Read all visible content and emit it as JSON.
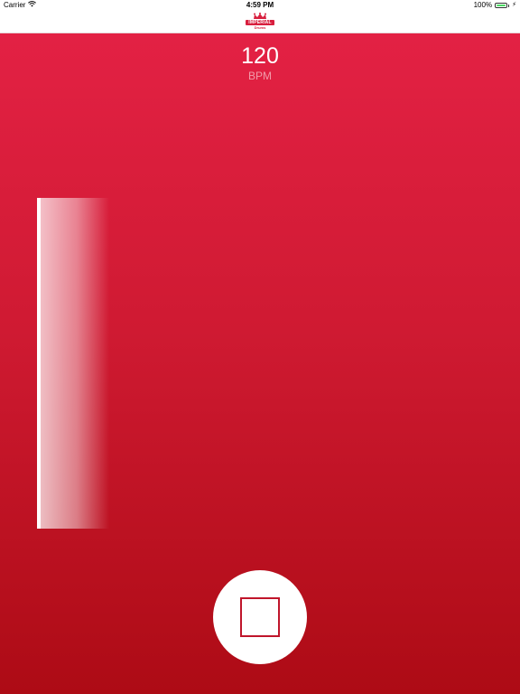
{
  "status_bar": {
    "carrier": "Carrier",
    "wifi_icon": "wifi-icon",
    "time": "4:59 PM",
    "battery_percent": "100%",
    "battery_level": 1.0,
    "battery_color": "#4cd964",
    "charging_icon": "charging-bolt-icon"
  },
  "header": {
    "logo": {
      "crown_icon": "crown-icon",
      "brand": "IMPERIAL",
      "subtitle": "Drums",
      "color": "#d81f3e"
    }
  },
  "metronome": {
    "tempo": "120",
    "unit": "BPM",
    "beat_indicator_active": true,
    "stop_icon": "stop-icon"
  },
  "colors": {
    "accent": "#d81f3e",
    "background_top": "#e32144",
    "background_bottom": "#ad0b15"
  }
}
